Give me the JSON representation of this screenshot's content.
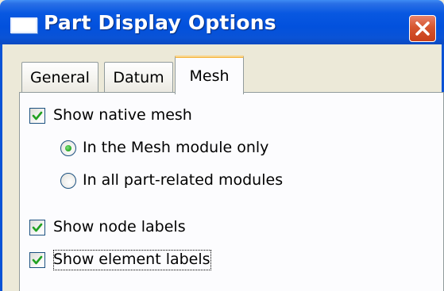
{
  "window": {
    "title": "Part Display Options",
    "icon": "dialog-window-icon",
    "close_icon": "close-x-icon",
    "titlebar_color": "#0251dd",
    "close_color": "#d6562f"
  },
  "tabs": [
    {
      "label": "General",
      "selected": false
    },
    {
      "label": "Datum",
      "selected": false
    },
    {
      "label": "Mesh",
      "selected": true
    }
  ],
  "mesh_panel": {
    "show_native_mesh": {
      "label": "Show native mesh",
      "checked": true
    },
    "native_mesh_scope": {
      "options": [
        {
          "label": "In the Mesh module only",
          "selected": true
        },
        {
          "label": "In all part-related modules",
          "selected": false
        }
      ]
    },
    "show_node_labels": {
      "label": "Show node labels",
      "checked": true
    },
    "show_element_labels": {
      "label": "Show element labels",
      "checked": true,
      "focused": true
    }
  },
  "colors": {
    "selected_tab_accent": "#f3b33b",
    "check_mark": "#21a121",
    "radio_dot": "#2fae2c"
  }
}
